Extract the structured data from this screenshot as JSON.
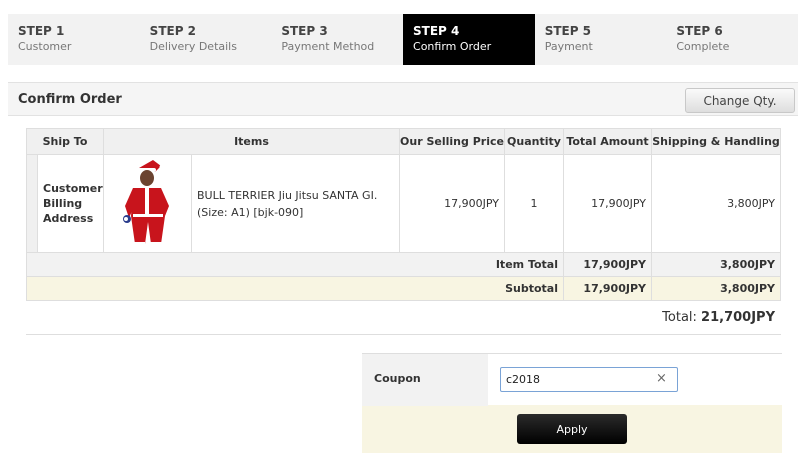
{
  "steps": [
    {
      "num": "STEP 1",
      "label": "Customer"
    },
    {
      "num": "STEP 2",
      "label": "Delivery Details"
    },
    {
      "num": "STEP 3",
      "label": "Payment Method"
    },
    {
      "num": "STEP 4",
      "label": "Confirm Order"
    },
    {
      "num": "STEP 5",
      "label": "Payment"
    },
    {
      "num": "STEP 6",
      "label": "Complete"
    }
  ],
  "active_step": 4,
  "section": {
    "title": "Confirm Order",
    "change_btn": "Change Qty."
  },
  "table": {
    "headers": [
      "Ship To",
      "Items",
      "Our Selling Price",
      "Quantity",
      "Total Amount",
      "Shipping & Handling"
    ],
    "row": {
      "ship_to": "Customer Billing Address",
      "item_name": "BULL TERRIER Jiu Jitsu SANTA GI. (Size: A1) [bjk-090]",
      "price": "17,900JPY",
      "qty": "1",
      "total": "17,900JPY",
      "shipping": "3,800JPY"
    },
    "item_total": {
      "label": "Item Total",
      "amount": "17,900JPY",
      "shipping": "3,800JPY"
    },
    "subtotal": {
      "label": "Subtotal",
      "amount": "17,900JPY",
      "shipping": "3,800JPY"
    }
  },
  "grand_total": {
    "label": "Total:",
    "value": "21,700JPY"
  },
  "coupon": {
    "label": "Coupon",
    "value": "c2018",
    "clear": "×",
    "apply": "Apply"
  },
  "colors": {
    "active_step": "#000000",
    "subtotal_bg": "#f8f5e2",
    "apply_bg": "#000000"
  }
}
